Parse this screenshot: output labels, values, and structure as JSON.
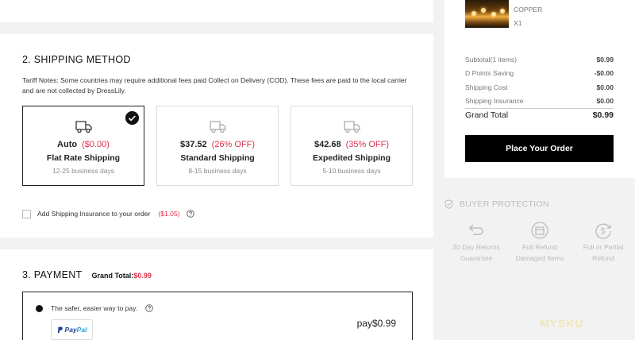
{
  "shipping": {
    "title": "2. SHIPPING METHOD",
    "notes": "Tariff Notes: Some countries may require additional fees paid Collect on Delivery (COD). These fees are paid to the local carrier and are not collected by DressLily.",
    "options": [
      {
        "price": "Auto",
        "discount": "($0.00)",
        "name": "Flat Rate Shipping",
        "days": "12-25 business days",
        "selected": true
      },
      {
        "price": "$37.52",
        "discount": "(26% OFF)",
        "name": "Standard Shipping",
        "days": "8-15 business days",
        "selected": false
      },
      {
        "price": "$42.68",
        "discount": "(35% OFF)",
        "name": "Expedited Shipping",
        "days": "5-10 business days",
        "selected": false
      }
    ],
    "insurance_label": "Add Shipping Insurance to your order",
    "insurance_price": "($1.05)"
  },
  "payment": {
    "title": "3. PAYMENT",
    "grand_total_label": "Grand Total:",
    "grand_total_value": "$0.99",
    "safer_text": "The safer, easier way to pay.",
    "paypal_a": "Pay",
    "paypal_b": "Pal",
    "pay_amount": "pay$0.99"
  },
  "order": {
    "product_name": "COPPER",
    "product_qty": "X1",
    "rows": [
      {
        "label": "Subtotal(1 items)",
        "value": "$0.99"
      },
      {
        "label": "D Points Saving",
        "value": "-$0.00"
      },
      {
        "label": "Shipping Cost",
        "value": "$0.00"
      },
      {
        "label": "Shipping Insurance",
        "value": "$0.00"
      }
    ],
    "grand_label": "Grand Total",
    "grand_value": "$0.99",
    "place_order": "Place Your Order"
  },
  "protection": {
    "title": "BUYER PROTECTION",
    "items": [
      {
        "line1": "30 Day Returns",
        "line2": "Guarantee",
        "icon": "return-arrow-icon"
      },
      {
        "line1": "Full Refund",
        "line2": "Damaged Items",
        "icon": "package-icon"
      },
      {
        "line1": "Full or Partial",
        "line2": "Refund",
        "icon": "dollar-refund-icon"
      }
    ]
  },
  "watermark": "MYSKU"
}
